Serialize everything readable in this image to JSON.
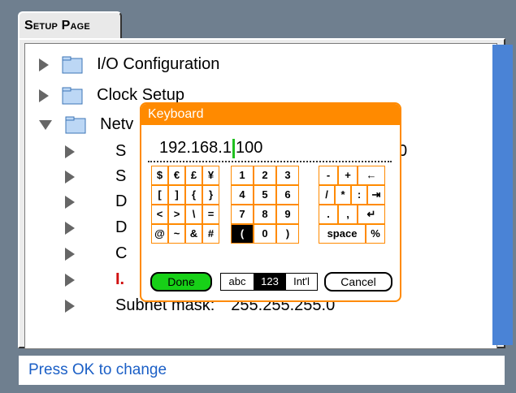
{
  "tab": {
    "label": "Setup Page"
  },
  "tree": {
    "items": [
      {
        "label": "I/O Configuration"
      },
      {
        "label": "Clock Setup"
      },
      {
        "label": "Netv"
      }
    ],
    "children": [
      {
        "label": "S",
        "value": "0"
      },
      {
        "label": "S",
        "value": ""
      },
      {
        "label": "D",
        "value": ""
      },
      {
        "label": "D",
        "value": ""
      },
      {
        "label": "C",
        "value": ""
      },
      {
        "label": "I.",
        "value": ""
      },
      {
        "label": "Subnet mask:",
        "value": "255.255.255.0"
      }
    ]
  },
  "status": {
    "text": "Press OK to change"
  },
  "keyboard": {
    "title": "Keyboard",
    "before_cursor": "192.168.1",
    "after_cursor": "100",
    "symbols": [
      [
        "$",
        "€",
        "£",
        "¥"
      ],
      [
        "[",
        "]",
        "{",
        "}"
      ],
      [
        "<",
        ">",
        "\\",
        "="
      ],
      [
        "@",
        "~",
        "&",
        "#"
      ]
    ],
    "numbers": [
      [
        "1",
        "2",
        "3"
      ],
      [
        "4",
        "5",
        "6"
      ],
      [
        "7",
        "8",
        "9"
      ],
      [
        "(",
        "0",
        ")"
      ]
    ],
    "ops": [
      [
        "-",
        "+",
        "←"
      ],
      [
        "/",
        "*",
        ":",
        "⇥"
      ],
      [
        ".",
        ",",
        "↵"
      ],
      [
        "space",
        "%"
      ]
    ],
    "buttons": {
      "done": "Done",
      "cancel": "Cancel"
    },
    "modes": [
      "abc",
      "123",
      "Int'l"
    ],
    "selected_mode": "123",
    "selected_key": "("
  },
  "colors": {
    "accent": "#ff8a00",
    "done": "#17d017",
    "status_text": "#1b5fc6"
  }
}
